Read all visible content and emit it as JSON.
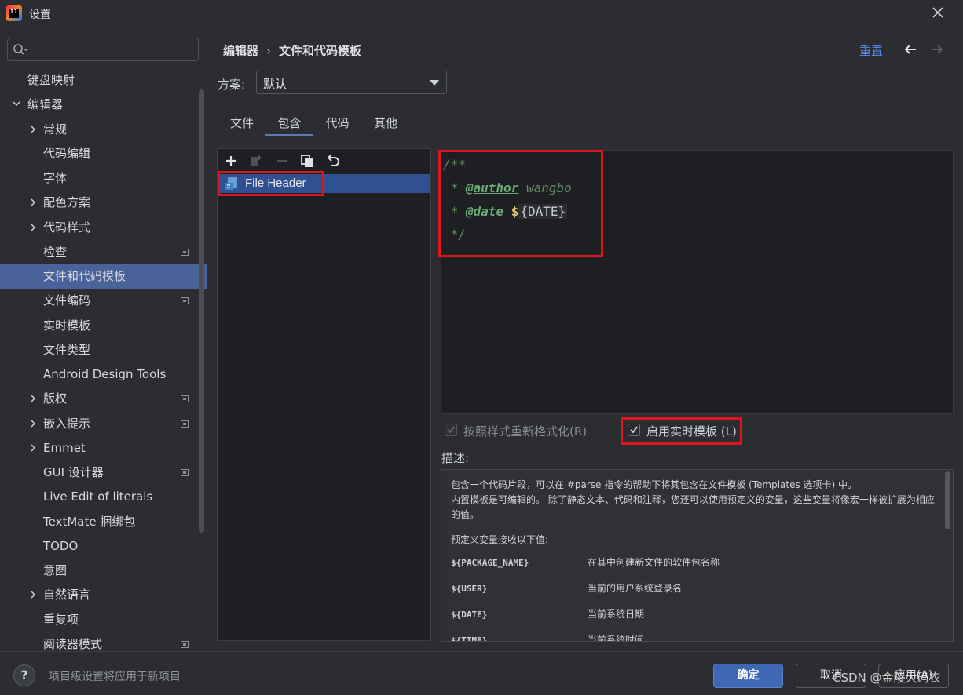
{
  "window": {
    "title": "设置"
  },
  "search": {
    "placeholder": ""
  },
  "sidebar": {
    "items": [
      {
        "label": "键盘映射"
      },
      {
        "label": "编辑器"
      },
      {
        "label": "常规"
      },
      {
        "label": "代码编辑"
      },
      {
        "label": "字体"
      },
      {
        "label": "配色方案"
      },
      {
        "label": "代码样式"
      },
      {
        "label": "检查"
      },
      {
        "label": "文件和代码模板"
      },
      {
        "label": "文件编码"
      },
      {
        "label": "实时模板"
      },
      {
        "label": "文件类型"
      },
      {
        "label": "Android Design Tools"
      },
      {
        "label": "版权"
      },
      {
        "label": "嵌入提示"
      },
      {
        "label": "Emmet"
      },
      {
        "label": "GUI 设计器"
      },
      {
        "label": "Live Edit of literals"
      },
      {
        "label": "TextMate 捆绑包"
      },
      {
        "label": "TODO"
      },
      {
        "label": "意图"
      },
      {
        "label": "自然语言"
      },
      {
        "label": "重复项"
      },
      {
        "label": "阅读器模式"
      }
    ]
  },
  "breadcrumb": {
    "parent": "编辑器",
    "separator": "›",
    "current": "文件和代码模板"
  },
  "header": {
    "reset": "重置"
  },
  "scheme": {
    "label": "方案:",
    "value": "默认"
  },
  "tabs": [
    {
      "label": "文件"
    },
    {
      "label": "包含"
    },
    {
      "label": "代码"
    },
    {
      "label": "其他"
    }
  ],
  "templates": [
    {
      "name": "File Header"
    }
  ],
  "editor": {
    "line1": "/**",
    "line2_prefix": " * ",
    "line2_tag": "@author",
    "line2_value": " wangbo",
    "line3_prefix": " * ",
    "line3_tag": "@date",
    "line3_dollar": " $",
    "line3_var": "{DATE}",
    "line4": " */"
  },
  "options": {
    "reformat": "按照样式重新格式化(R)",
    "live_templates": "启用实时模板 (L)"
  },
  "description": {
    "label": "描述:",
    "p1": "包含一个代码片段，可以在 #parse 指令的帮助下将其包含在文件模板 (Templates 选项卡) 中。",
    "p2": "内置模板是可编辑的。 除了静态文本、代码和注释，您还可以使用预定义的变量，这些变量将像宏一样被扩展为相应的值。",
    "p3": "预定义变量接收以下值:",
    "vars": [
      {
        "name": "${PACKAGE_NAME}",
        "desc": "在其中创建新文件的软件包名称"
      },
      {
        "name": "${USER}",
        "desc": "当前的用户系统登录名"
      },
      {
        "name": "${DATE}",
        "desc": "当前系统日期"
      },
      {
        "name": "${TIME}",
        "desc": "当前系统时间"
      }
    ]
  },
  "footer": {
    "help": "?",
    "note": "项目级设置将应用于新项目",
    "ok": "确定",
    "cancel": "取消",
    "apply": "应用(A)",
    "watermark": "CSDN @金陵大码农"
  }
}
